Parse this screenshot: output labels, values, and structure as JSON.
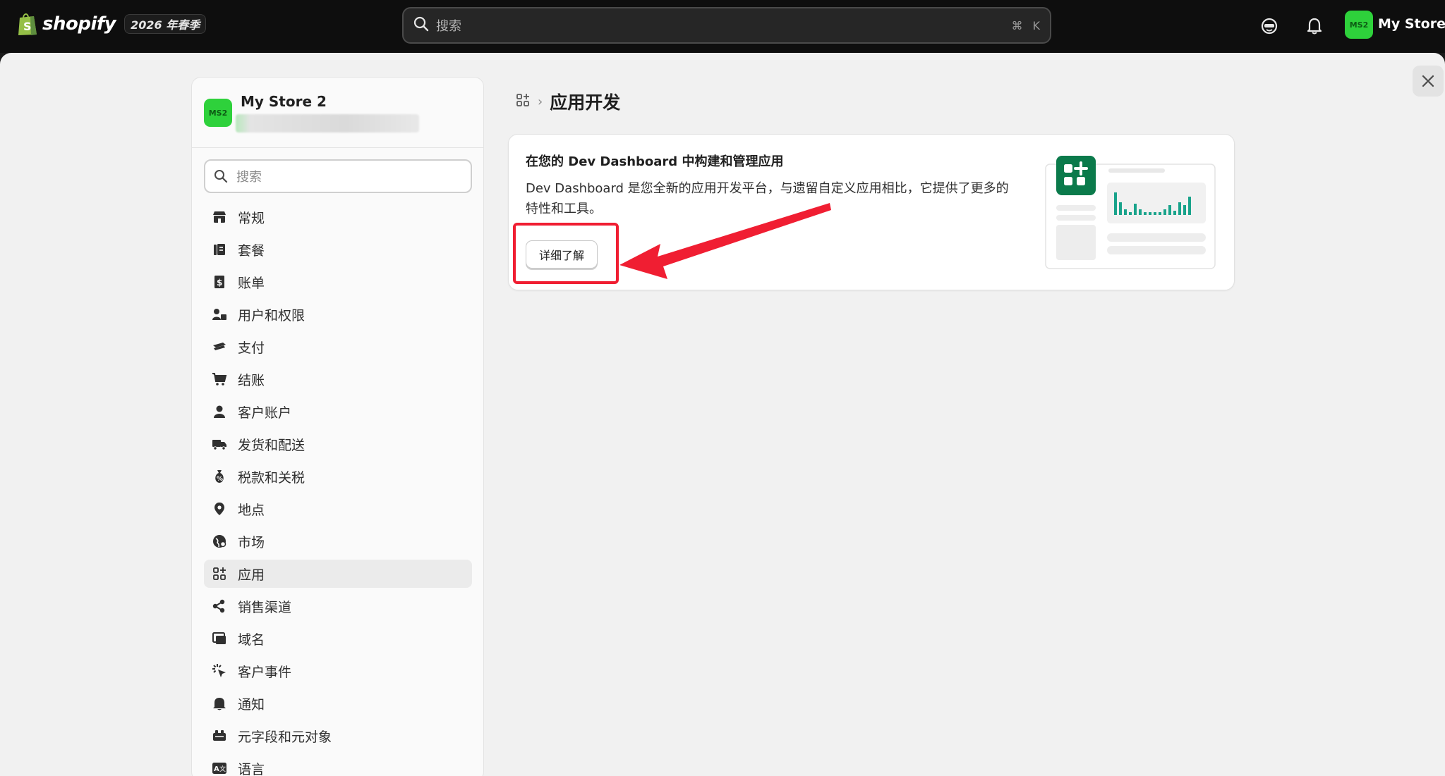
{
  "topbar": {
    "brand": "shopify",
    "edition": "2026 年春季",
    "search_placeholder": "搜索",
    "search_shortcut_cmd": "⌘",
    "search_shortcut_key": "K",
    "store_badge": "MS2",
    "store_name": "My Store 2"
  },
  "sidebar": {
    "store_badge": "MS2",
    "store_name": "My Store 2",
    "search_placeholder": "搜索",
    "items": [
      {
        "label": "常规",
        "icon": "store-icon"
      },
      {
        "label": "套餐",
        "icon": "plan-icon"
      },
      {
        "label": "账单",
        "icon": "billing-icon"
      },
      {
        "label": "用户和权限",
        "icon": "users-icon"
      },
      {
        "label": "支付",
        "icon": "payment-icon"
      },
      {
        "label": "结账",
        "icon": "cart-icon"
      },
      {
        "label": "客户账户",
        "icon": "person-icon"
      },
      {
        "label": "发货和配送",
        "icon": "truck-icon"
      },
      {
        "label": "税款和关税",
        "icon": "tax-icon"
      },
      {
        "label": "地点",
        "icon": "location-icon"
      },
      {
        "label": "市场",
        "icon": "globe-icon"
      },
      {
        "label": "应用",
        "icon": "apps-icon",
        "active": true
      },
      {
        "label": "销售渠道",
        "icon": "channels-icon"
      },
      {
        "label": "域名",
        "icon": "domain-icon"
      },
      {
        "label": "客户事件",
        "icon": "events-icon"
      },
      {
        "label": "通知",
        "icon": "bell-icon"
      },
      {
        "label": "元字段和元对象",
        "icon": "metafields-icon"
      },
      {
        "label": "语言",
        "icon": "language-icon"
      }
    ]
  },
  "main": {
    "breadcrumb_title": "应用开发",
    "card": {
      "title": "在您的 Dev Dashboard 中构建和管理应用",
      "description": "Dev Dashboard 是您全新的应用开发平台，与遗留自定义应用相比，它提供了更多的特性和工具。",
      "button_label": "详细了解"
    }
  },
  "colors": {
    "topbar_bg": "#0e0e0e",
    "store_badge": "#2ed13b",
    "accent_green": "#0b7a4b",
    "annotation_red": "#f01e32"
  }
}
